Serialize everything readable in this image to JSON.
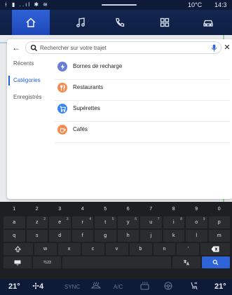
{
  "status": {
    "signals": "ᚼ ▮ ..ıl ✱ ≋",
    "temperature": "10°C",
    "time": "14:3"
  },
  "nav": {
    "tabs": [
      {
        "icon": "home-icon",
        "active": true
      },
      {
        "icon": "music-icon",
        "active": false
      },
      {
        "icon": "phone-icon",
        "active": false
      },
      {
        "icon": "apps-icon",
        "active": false
      },
      {
        "icon": "car-icon",
        "active": false
      }
    ]
  },
  "search": {
    "placeholder": "Rechercher sur votre trajet",
    "value": ""
  },
  "sidebar": {
    "items": [
      {
        "label": "Récents",
        "active": false
      },
      {
        "label": "Catégories",
        "active": true
      },
      {
        "label": "Enregistrés",
        "active": false
      }
    ]
  },
  "categories": [
    {
      "label": "Bornes de recharge",
      "icon": "charging-station-icon",
      "color": "#6a7dd6"
    },
    {
      "label": "Restaurants",
      "icon": "restaurant-icon",
      "color": "#f28c53"
    },
    {
      "label": "Supérettes",
      "icon": "shopping-cart-icon",
      "color": "#3a86f0"
    },
    {
      "label": "Cafés",
      "icon": "coffee-icon",
      "color": "#f28c53"
    }
  ],
  "keyboard": {
    "numbers": [
      "1",
      "2",
      "3",
      "4",
      "5",
      "6",
      "7",
      "8",
      "9",
      "0"
    ],
    "row1": [
      [
        "a",
        ""
      ],
      [
        "z",
        "2"
      ],
      [
        "e",
        "3"
      ],
      [
        "r",
        "4"
      ],
      [
        "t",
        "5"
      ],
      [
        "y",
        "6"
      ],
      [
        "u",
        "7"
      ],
      [
        "i",
        "8"
      ],
      [
        "o",
        "9"
      ],
      [
        "p",
        ""
      ]
    ],
    "row2": [
      "q",
      "s",
      "d",
      "f",
      "g",
      "h",
      "j",
      "k",
      "l",
      "m"
    ],
    "row3": [
      "w",
      "x",
      "c",
      "v",
      "b",
      "n",
      "'"
    ],
    "mode_label": "?123",
    "search_key": "search-icon"
  },
  "climate": {
    "left_temp": "21°",
    "fan": "4",
    "sync": "SYNC",
    "ac": "A/C",
    "right_temp": "21°"
  }
}
